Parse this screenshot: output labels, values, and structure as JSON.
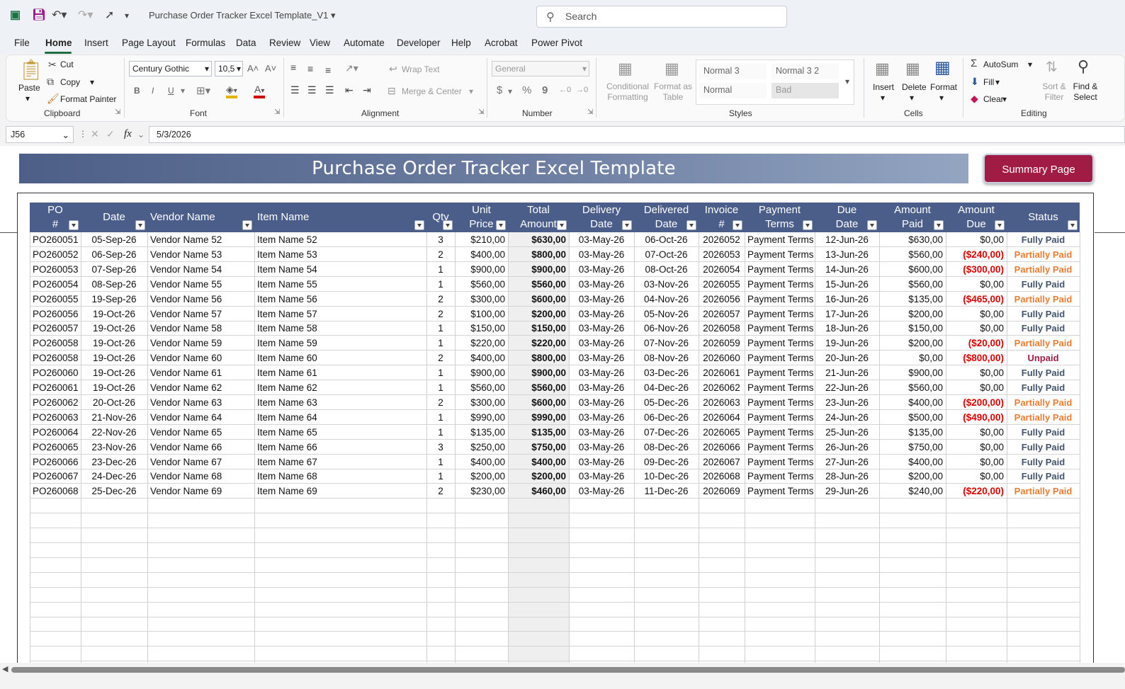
{
  "titlebar": {
    "title": "Purchase Order Tracker Excel Template_V1",
    "search_placeholder": "Search"
  },
  "menu": [
    "File",
    "Home",
    "Insert",
    "Page Layout",
    "Formulas",
    "Data",
    "Review",
    "View",
    "Automate",
    "Developer",
    "Help",
    "Acrobat",
    "Power Pivot"
  ],
  "ribbon": {
    "clipboard": {
      "paste": "Paste",
      "cut": "Cut",
      "copy": "Copy",
      "format_painter": "Format Painter",
      "label": "Clipboard"
    },
    "font": {
      "name": "Century Gothic",
      "size": "10,5",
      "bold": "B",
      "italic": "I",
      "underline": "U",
      "label": "Font"
    },
    "alignment": {
      "wrap": "Wrap Text",
      "merge": "Merge & Center",
      "label": "Alignment"
    },
    "number": {
      "format": "General",
      "currency": "$",
      "percent": "%",
      "comma": "9",
      "label": "Number"
    },
    "styles": {
      "conditional": "Conditional Formatting",
      "format_as_table": "Format as Table",
      "boxes": [
        "Normal 3",
        "Normal 3 2",
        "Normal",
        "Bad"
      ],
      "label": "Styles"
    },
    "cells": {
      "insert": "Insert",
      "delete": "Delete",
      "format": "Format",
      "label": "Cells"
    },
    "editing": {
      "autosum": "AutoSum",
      "fill": "Fill",
      "clear": "Clear",
      "sort": "Sort & Filter",
      "find": "Find & Select",
      "label": "Editing"
    }
  },
  "formula_bar": {
    "name_box": "J56",
    "value": "5/3/2026",
    "fx": "fx"
  },
  "sheet": {
    "title": "Purchase Order Tracker Excel Template",
    "summary_button": "Summary Page",
    "colors": {
      "header": "#4b5e8a",
      "paid": "#44546a",
      "partial": "#ed7d31",
      "unpaid": "#a01c45",
      "negative": "#e00000",
      "button": "#a01c45"
    },
    "columns": [
      {
        "l1": "PO",
        "l2": "#"
      },
      {
        "l1": "Date",
        "l2": ""
      },
      {
        "l1": "Vendor Name",
        "l2": ""
      },
      {
        "l1": "Item Name",
        "l2": ""
      },
      {
        "l1": "Qty",
        "l2": ""
      },
      {
        "l1": "Unit",
        "l2": "Price"
      },
      {
        "l1": "Total",
        "l2": "Amount"
      },
      {
        "l1": "Delivery",
        "l2": "Date"
      },
      {
        "l1": "Delivered",
        "l2": "Date"
      },
      {
        "l1": "Invoice",
        "l2": "#"
      },
      {
        "l1": "Payment",
        "l2": "Terms"
      },
      {
        "l1": "Due",
        "l2": "Date"
      },
      {
        "l1": "Amount",
        "l2": "Paid"
      },
      {
        "l1": "Amount",
        "l2": "Due"
      },
      {
        "l1": "Status",
        "l2": ""
      }
    ],
    "rows": [
      [
        "PO260051",
        "05-Sep-26",
        "Vendor Name 52",
        "Item Name 52",
        "3",
        "$210,00",
        "$630,00",
        "03-May-26",
        "06-Oct-26",
        "2026052",
        "Payment Terms",
        "12-Jun-26",
        "$630,00",
        "$0,00",
        "Fully Paid"
      ],
      [
        "PO260052",
        "06-Sep-26",
        "Vendor Name 53",
        "Item Name 53",
        "2",
        "$400,00",
        "$800,00",
        "03-May-26",
        "07-Oct-26",
        "2026053",
        "Payment Terms",
        "13-Jun-26",
        "$560,00",
        "($240,00)",
        "Partially Paid"
      ],
      [
        "PO260053",
        "07-Sep-26",
        "Vendor Name 54",
        "Item Name 54",
        "1",
        "$900,00",
        "$900,00",
        "03-May-26",
        "08-Oct-26",
        "2026054",
        "Payment Terms",
        "14-Jun-26",
        "$600,00",
        "($300,00)",
        "Partially Paid"
      ],
      [
        "PO260054",
        "08-Sep-26",
        "Vendor Name 55",
        "Item Name 55",
        "1",
        "$560,00",
        "$560,00",
        "03-May-26",
        "03-Nov-26",
        "2026055",
        "Payment Terms",
        "15-Jun-26",
        "$560,00",
        "$0,00",
        "Fully Paid"
      ],
      [
        "PO260055",
        "19-Sep-26",
        "Vendor Name 56",
        "Item Name 56",
        "2",
        "$300,00",
        "$600,00",
        "03-May-26",
        "04-Nov-26",
        "2026056",
        "Payment Terms",
        "16-Jun-26",
        "$135,00",
        "($465,00)",
        "Partially Paid"
      ],
      [
        "PO260056",
        "19-Oct-26",
        "Vendor Name 57",
        "Item Name 57",
        "2",
        "$100,00",
        "$200,00",
        "03-May-26",
        "05-Nov-26",
        "2026057",
        "Payment Terms",
        "17-Jun-26",
        "$200,00",
        "$0,00",
        "Fully Paid"
      ],
      [
        "PO260057",
        "19-Oct-26",
        "Vendor Name 58",
        "Item Name 58",
        "1",
        "$150,00",
        "$150,00",
        "03-May-26",
        "06-Nov-26",
        "2026058",
        "Payment Terms",
        "18-Jun-26",
        "$150,00",
        "$0,00",
        "Fully Paid"
      ],
      [
        "PO260058",
        "19-Oct-26",
        "Vendor Name 59",
        "Item Name 59",
        "1",
        "$220,00",
        "$220,00",
        "03-May-26",
        "07-Nov-26",
        "2026059",
        "Payment Terms",
        "19-Jun-26",
        "$200,00",
        "($20,00)",
        "Partially Paid"
      ],
      [
        "PO260058",
        "19-Oct-26",
        "Vendor Name 60",
        "Item Name 60",
        "2",
        "$400,00",
        "$800,00",
        "03-May-26",
        "08-Nov-26",
        "2026060",
        "Payment Terms",
        "20-Jun-26",
        "$0,00",
        "($800,00)",
        "Unpaid"
      ],
      [
        "PO260060",
        "19-Oct-26",
        "Vendor Name 61",
        "Item Name 61",
        "1",
        "$900,00",
        "$900,00",
        "03-May-26",
        "03-Dec-26",
        "2026061",
        "Payment Terms",
        "21-Jun-26",
        "$900,00",
        "$0,00",
        "Fully Paid"
      ],
      [
        "PO260061",
        "19-Oct-26",
        "Vendor Name 62",
        "Item Name 62",
        "1",
        "$560,00",
        "$560,00",
        "03-May-26",
        "04-Dec-26",
        "2026062",
        "Payment Terms",
        "22-Jun-26",
        "$560,00",
        "$0,00",
        "Fully Paid"
      ],
      [
        "PO260062",
        "20-Oct-26",
        "Vendor Name 63",
        "Item Name 63",
        "2",
        "$300,00",
        "$600,00",
        "03-May-26",
        "05-Dec-26",
        "2026063",
        "Payment Terms",
        "23-Jun-26",
        "$400,00",
        "($200,00)",
        "Partially Paid"
      ],
      [
        "PO260063",
        "21-Nov-26",
        "Vendor Name 64",
        "Item Name 64",
        "1",
        "$990,00",
        "$990,00",
        "03-May-26",
        "06-Dec-26",
        "2026064",
        "Payment Terms",
        "24-Jun-26",
        "$500,00",
        "($490,00)",
        "Partially Paid"
      ],
      [
        "PO260064",
        "22-Nov-26",
        "Vendor Name 65",
        "Item Name 65",
        "1",
        "$135,00",
        "$135,00",
        "03-May-26",
        "07-Dec-26",
        "2026065",
        "Payment Terms",
        "25-Jun-26",
        "$135,00",
        "$0,00",
        "Fully Paid"
      ],
      [
        "PO260065",
        "23-Nov-26",
        "Vendor Name 66",
        "Item Name 66",
        "3",
        "$250,00",
        "$750,00",
        "03-May-26",
        "08-Dec-26",
        "2026066",
        "Payment Terms",
        "26-Jun-26",
        "$750,00",
        "$0,00",
        "Fully Paid"
      ],
      [
        "PO260066",
        "23-Dec-26",
        "Vendor Name 67",
        "Item Name 67",
        "1",
        "$400,00",
        "$400,00",
        "03-May-26",
        "09-Dec-26",
        "2026067",
        "Payment Terms",
        "27-Jun-26",
        "$400,00",
        "$0,00",
        "Fully Paid"
      ],
      [
        "PO260067",
        "24-Dec-26",
        "Vendor Name 68",
        "Item Name 68",
        "1",
        "$200,00",
        "$200,00",
        "03-May-26",
        "10-Dec-26",
        "2026068",
        "Payment Terms",
        "28-Jun-26",
        "$200,00",
        "$0,00",
        "Fully Paid"
      ],
      [
        "PO260068",
        "25-Dec-26",
        "Vendor Name 69",
        "Item Name 69",
        "2",
        "$230,00",
        "$460,00",
        "03-May-26",
        "11-Dec-26",
        "2026069",
        "Payment Terms",
        "29-Jun-26",
        "$240,00",
        "($220,00)",
        "Partially Paid"
      ]
    ]
  }
}
